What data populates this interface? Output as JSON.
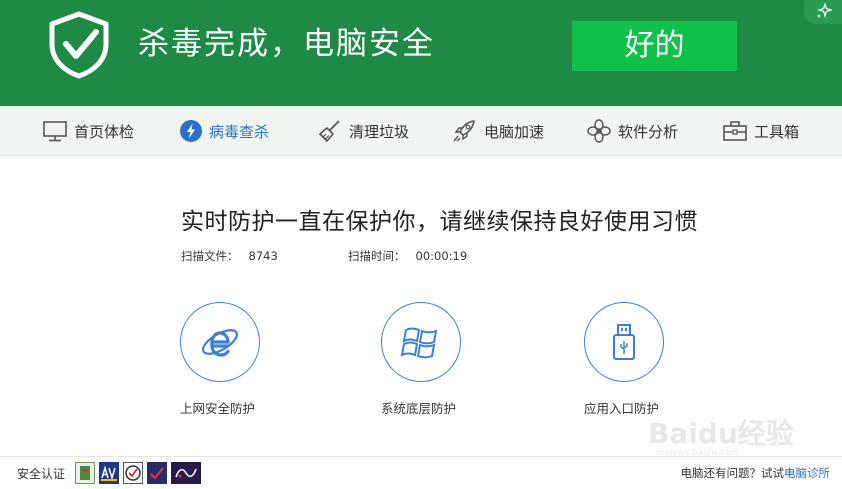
{
  "header": {
    "title": "杀毒完成，电脑安全",
    "ok_button": "好的",
    "logo_icon": "shield-check-icon",
    "corner_icon": "sparkle-icon",
    "colors": {
      "green": "#1f8a45",
      "button": "#0fc04a"
    }
  },
  "nav": {
    "items": [
      {
        "label": "首页体检",
        "icon": "monitor-icon"
      },
      {
        "label": "病毒查杀",
        "icon": "lightning-icon",
        "active": true
      },
      {
        "label": "清理垃圾",
        "icon": "broom-icon"
      },
      {
        "label": "电脑加速",
        "icon": "rocket-icon"
      },
      {
        "label": "软件分析",
        "icon": "fan-icon"
      },
      {
        "label": "工具箱",
        "icon": "toolbox-icon"
      }
    ],
    "active_color": "#2a72c9"
  },
  "main": {
    "headline": "实时防护一直在保护你，请继续保持良好使用习惯",
    "files_label": "扫描文件：",
    "files_value": "8743",
    "time_label": "扫描时间：",
    "time_value": "00:00:19",
    "features": [
      {
        "label": "上网安全防护",
        "icon": "ie-browser-icon"
      },
      {
        "label": "系统底层防护",
        "icon": "windows-icon"
      },
      {
        "label": "应用入口防护",
        "icon": "usb-icon"
      }
    ]
  },
  "footer": {
    "cert_label": "安全认证",
    "help_text": "电脑还有问题？试试",
    "help_link": "电脑诊所"
  },
  "watermark": {
    "text": "Baidu经验",
    "sub": "jingyan.baidu.com"
  }
}
